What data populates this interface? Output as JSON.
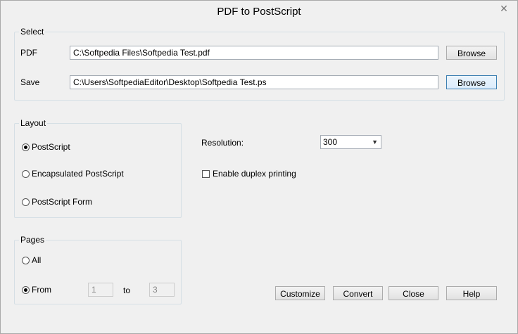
{
  "window": {
    "title": "PDF to PostScript"
  },
  "select_group": {
    "label": "Select",
    "pdf_label": "PDF",
    "pdf_value": "C:\\Softpedia Files\\Softpedia Test.pdf",
    "save_label": "Save",
    "save_value": "C:\\Users\\SoftpediaEditor\\Desktop\\Softpedia Test.ps",
    "browse_label": "Browse"
  },
  "layout_group": {
    "label": "Layout",
    "options": [
      {
        "label": "PostScript",
        "checked": true
      },
      {
        "label": "Encapsulated PostScript",
        "checked": false
      },
      {
        "label": "PostScript Form",
        "checked": false
      }
    ]
  },
  "resolution": {
    "label": "Resolution:",
    "value": "300"
  },
  "duplex": {
    "label": "Enable duplex printing",
    "checked": false
  },
  "pages_group": {
    "label": "Pages",
    "all_label": "All",
    "from_label": "From",
    "from_value": "1",
    "to_label": "to",
    "to_value": "3",
    "selected": "From"
  },
  "buttons": {
    "customize": "Customize",
    "convert": "Convert",
    "close": "Close",
    "help": "Help"
  },
  "icons": {
    "close": "close-icon",
    "dropdown": "chevron-down-icon"
  }
}
